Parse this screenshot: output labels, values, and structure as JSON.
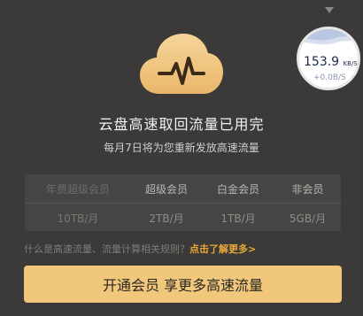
{
  "title": "云盘高速取回流量已用完",
  "subtitle": "每月7日将为您重新发放高速流量",
  "speed": {
    "value": "153.9",
    "unit": "KB/S",
    "delta": "+0.0B/S"
  },
  "table": {
    "headers": [
      "年费超级会员",
      "超级会员",
      "白金会员",
      "非会员"
    ],
    "values": [
      "10TB/月",
      "2TB/月",
      "1TB/月",
      "5GB/月"
    ]
  },
  "hint": {
    "text": "什么是高速流量、流量计算相关规则？",
    "link": "点击了解更多>"
  },
  "cta_label": "开通会员 享更多高速流量",
  "icons": [
    "chevron-down-icon",
    "cloud-pulse-icon",
    "speed-wave-icon"
  ],
  "colors": {
    "background": "#3b3a39",
    "accent": "#f1c87b",
    "link": "#e9a836"
  }
}
